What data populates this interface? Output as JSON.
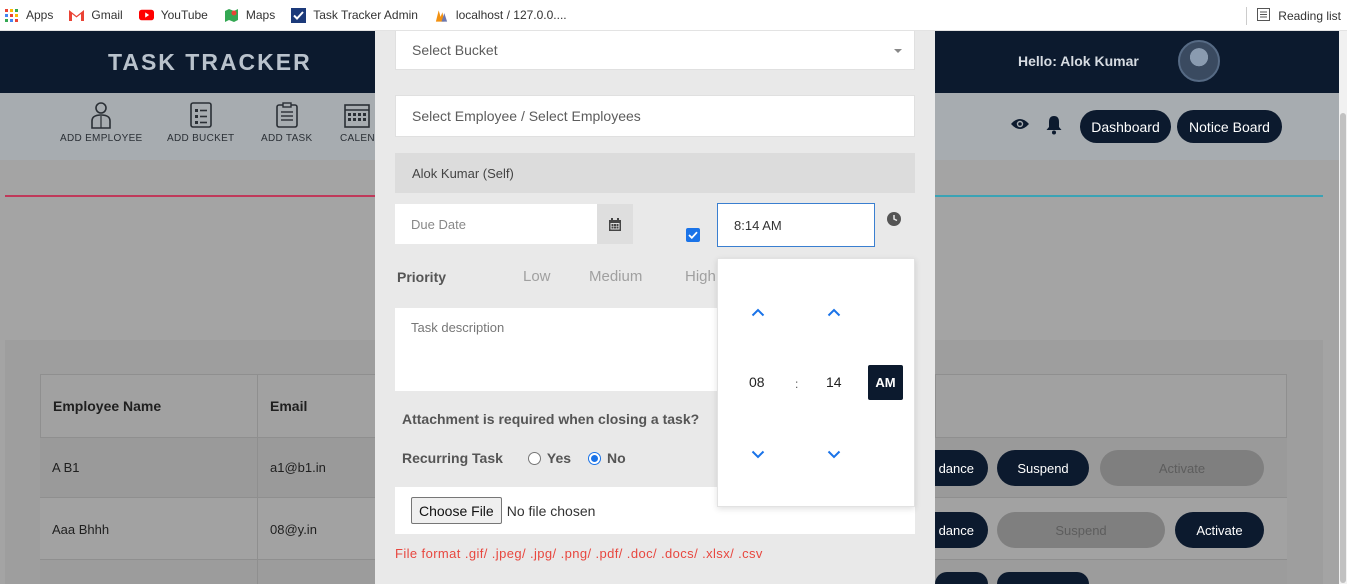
{
  "bookmarks": {
    "items": [
      {
        "label": "Apps",
        "icon": "apps-grid-icon"
      },
      {
        "label": "Gmail",
        "icon": "gmail-icon"
      },
      {
        "label": "YouTube",
        "icon": "youtube-icon"
      },
      {
        "label": "Maps",
        "icon": "maps-icon"
      },
      {
        "label": "Task Tracker Admin",
        "icon": "checkbox-icon"
      },
      {
        "label": "localhost / 127.0.0....",
        "icon": "phpmyadmin-icon"
      }
    ],
    "reading_list": "Reading list"
  },
  "header": {
    "logo": "TASK TRACKER",
    "greeting": "Hello: Alok Kumar"
  },
  "toolbar": {
    "tools": [
      "ADD EMPLOYEE",
      "ADD BUCKET",
      "ADD TASK",
      "CALEN"
    ],
    "dashboard": "Dashboard",
    "notice_board": "Notice Board"
  },
  "table": {
    "headers": [
      "Employee Name",
      "Email"
    ],
    "rows": [
      {
        "name": "A B1",
        "email": "a1@b1.in",
        "b1": "dance",
        "b2": "Suspend",
        "b3": "Activate"
      },
      {
        "name": "Aaa Bhhh",
        "email": "08@y.in",
        "b1": "dance",
        "b2": "Suspend",
        "b3": "Activate"
      }
    ]
  },
  "modal": {
    "bucket_placeholder": "Select Bucket",
    "employee_placeholder": "Select Employee / Select Employees",
    "self_option": "Alok Kumar (Self)",
    "due_date_placeholder": "Due Date",
    "time_value": "8:14 AM",
    "priority_label": "Priority",
    "priority_options": [
      "Low",
      "Medium",
      "High"
    ],
    "description_placeholder": "Task description",
    "attachment_label": "Attachment is required when closing a task?",
    "recurring_label": "Recurring Task",
    "recurring_yes": "Yes",
    "recurring_no": "No",
    "choose_file": "Choose File",
    "no_file": "No file chosen",
    "file_formats": "File format .gif/ .jpeg/ .jpg/ .png/ .pdf/ .doc/ .docs/ .xlsx/ .csv"
  },
  "time_picker": {
    "hour": "08",
    "colon": ":",
    "minute": "14",
    "period": "AM"
  },
  "colors": {
    "navy": "#0c1a2e",
    "accent_blue": "#1a73e8",
    "error_red": "#e8473f"
  }
}
